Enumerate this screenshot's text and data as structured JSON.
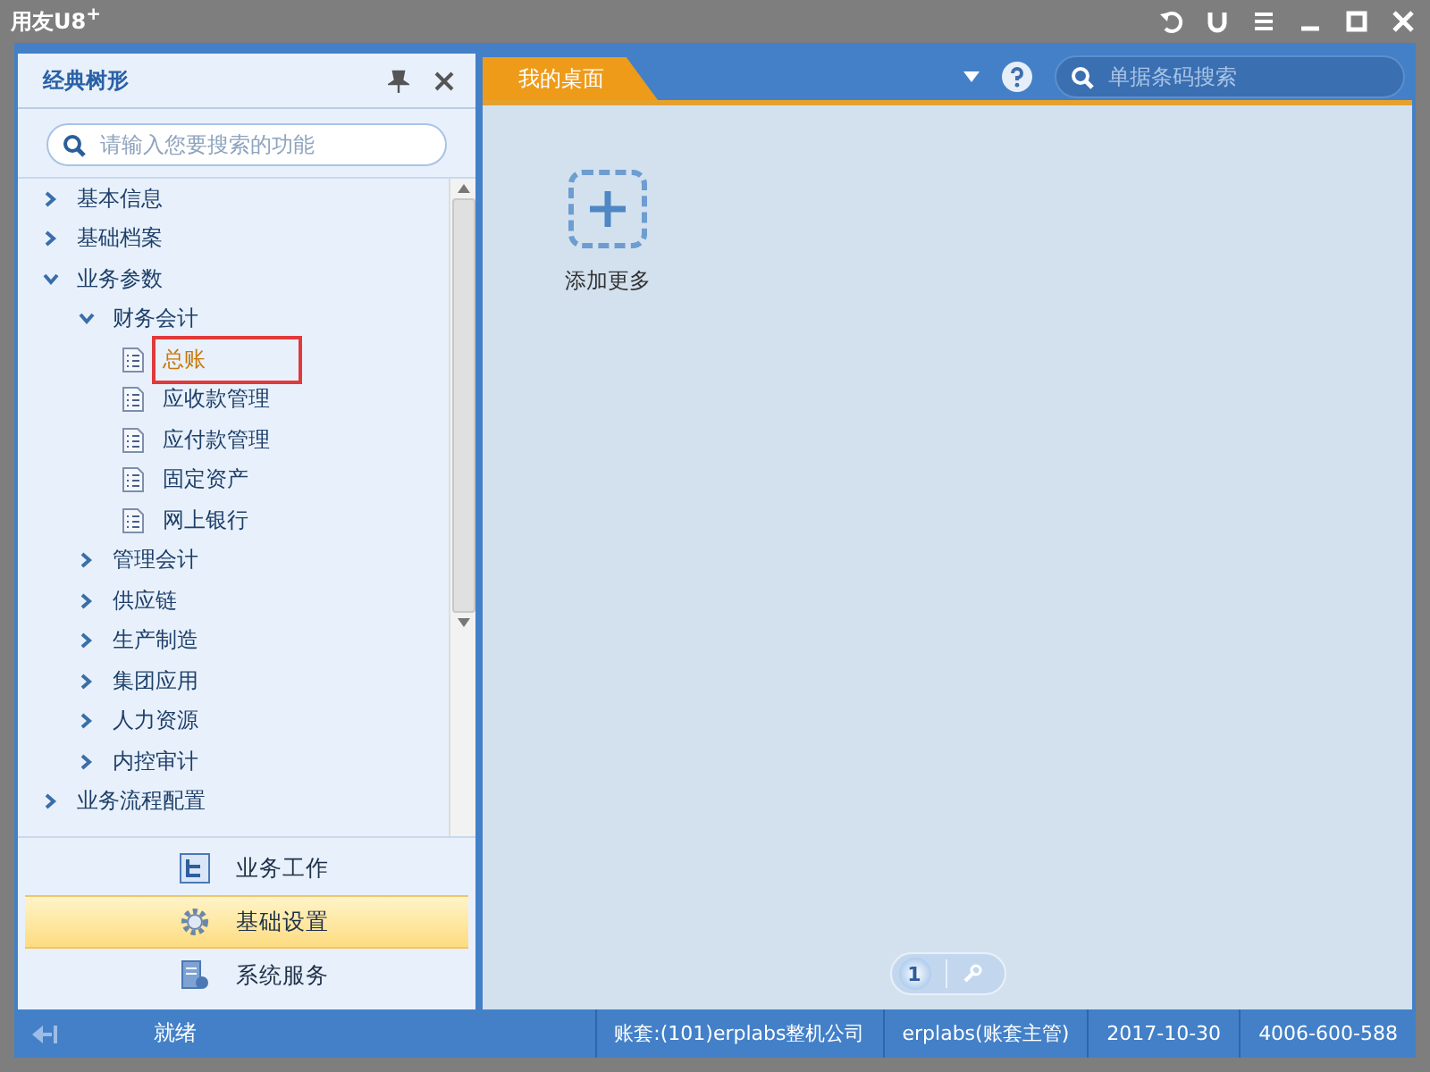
{
  "window": {
    "title": "用友U8",
    "title_sup": "+"
  },
  "sidebar": {
    "title": "经典树形",
    "search": {
      "placeholder": "请输入您要搜索的功能"
    },
    "tree": [
      {
        "label": "基本信息",
        "kind": "folder",
        "expanded": false,
        "selected": false
      },
      {
        "label": "基础档案",
        "kind": "folder",
        "expanded": false,
        "selected": false
      },
      {
        "label": "业务参数",
        "kind": "folder",
        "expanded": true,
        "selected": false,
        "children": [
          {
            "label": "财务会计",
            "kind": "folder",
            "expanded": true,
            "selected": false,
            "children": [
              {
                "label": "总账",
                "kind": "doc",
                "selected": true
              },
              {
                "label": "应收款管理",
                "kind": "doc",
                "selected": false
              },
              {
                "label": "应付款管理",
                "kind": "doc",
                "selected": false
              },
              {
                "label": "固定资产",
                "kind": "doc",
                "selected": false
              },
              {
                "label": "网上银行",
                "kind": "doc",
                "selected": false
              }
            ]
          },
          {
            "label": "管理会计",
            "kind": "folder",
            "expanded": false,
            "selected": false
          },
          {
            "label": "供应链",
            "kind": "folder",
            "expanded": false,
            "selected": false
          },
          {
            "label": "生产制造",
            "kind": "folder",
            "expanded": false,
            "selected": false
          },
          {
            "label": "集团应用",
            "kind": "folder",
            "expanded": false,
            "selected": false
          },
          {
            "label": "人力资源",
            "kind": "folder",
            "expanded": false,
            "selected": false
          },
          {
            "label": "内控审计",
            "kind": "folder",
            "expanded": false,
            "selected": false
          }
        ]
      },
      {
        "label": "业务流程配置",
        "kind": "folder",
        "expanded": false,
        "selected": false
      }
    ],
    "nav": [
      {
        "label": "业务工作",
        "kind": "work",
        "selected": false
      },
      {
        "label": "基础设置",
        "kind": "settings",
        "selected": true
      },
      {
        "label": "系统服务",
        "kind": "service",
        "selected": false
      }
    ]
  },
  "tabs": [
    {
      "label": "我的桌面",
      "selected": true
    }
  ],
  "search": {
    "placeholder": "单据条码搜索"
  },
  "desktop": {
    "add_label": "添加更多",
    "pages": [
      {
        "label": "1",
        "selected": true
      }
    ]
  },
  "status_bar": {
    "status": "就绪",
    "items": [
      "账套:(101)erplabs整机公司",
      "erplabs(账套主管)",
      "2017-10-30",
      "4006-600-588"
    ]
  }
}
